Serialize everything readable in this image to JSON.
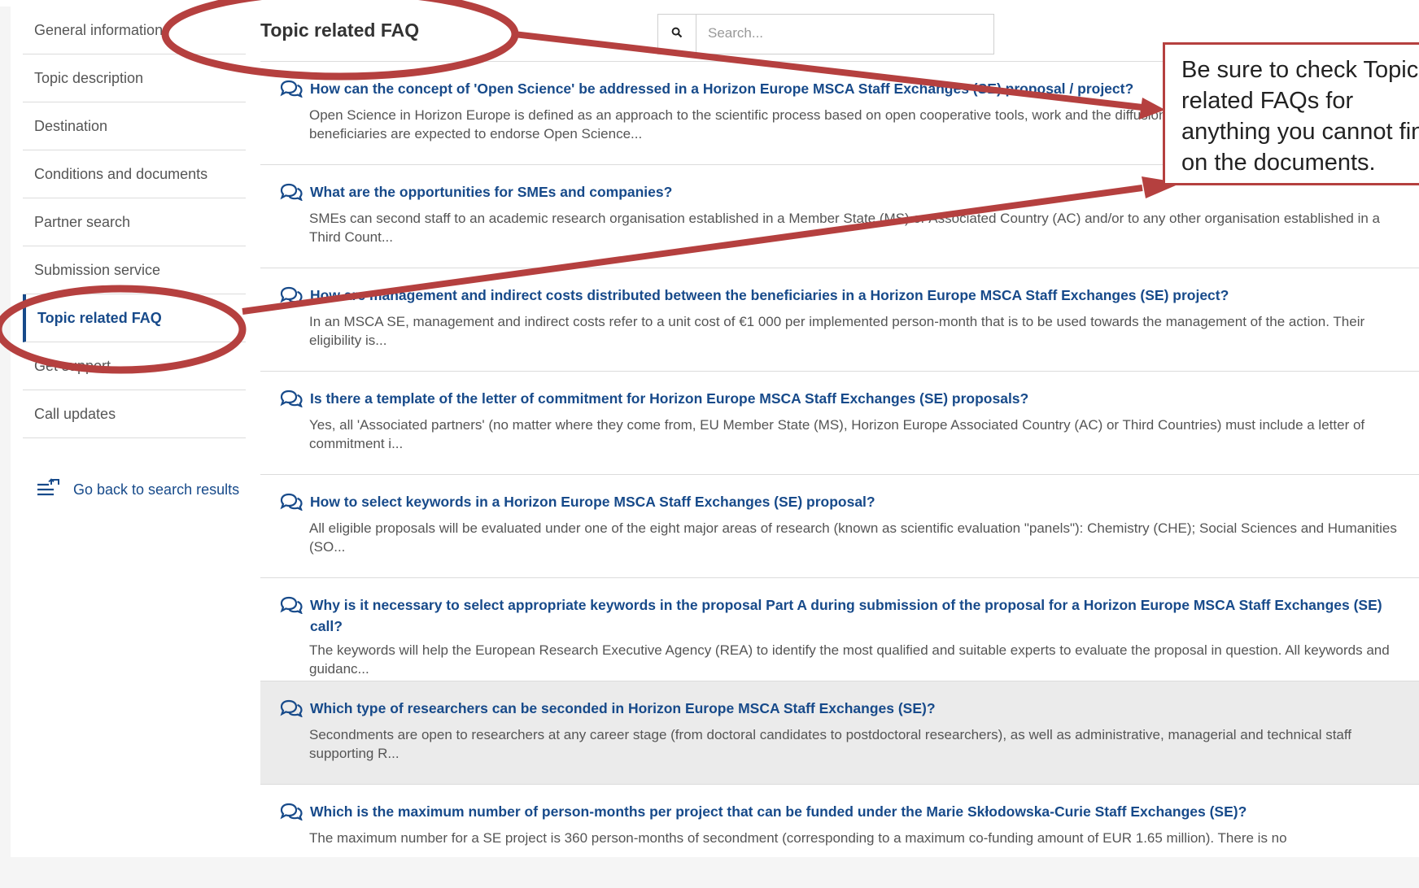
{
  "sidebar": {
    "items": [
      {
        "label": "General information"
      },
      {
        "label": "Topic description"
      },
      {
        "label": "Destination"
      },
      {
        "label": "Conditions and documents"
      },
      {
        "label": "Partner search"
      },
      {
        "label": "Submission service"
      },
      {
        "label": "Topic related FAQ",
        "active": true
      },
      {
        "label": "Get support"
      },
      {
        "label": "Call updates"
      }
    ],
    "back_link": "Go back to search results"
  },
  "header": {
    "title": "Topic related FAQ",
    "search_placeholder": "Search..."
  },
  "faqs": [
    {
      "q": "How can the concept of 'Open Science' be addressed in a Horizon Europe MSCA Staff Exchanges (SE) proposal / project?",
      "a": "Open Science in Horizon Europe is defined as an approach to the scientific process based on open cooperative tools, work and the diffusion of knowledge. All applicants and beneficiaries are expected to endorse Open Science..."
    },
    {
      "q": "What are the opportunities for SMEs and companies?",
      "a": "SMEs can second staff to an academic research organisation established in a Member State (MS) or Associated Country (AC) and/or to any other organisation established in a Third Count..."
    },
    {
      "q": "How are management and indirect costs distributed between the beneficiaries in a Horizon Europe MSCA Staff Exchanges (SE) project?",
      "a": "In an MSCA SE, management and indirect costs refer to a unit cost of €1 000 per implemented person-month that is to be used towards the management of the action. Their eligibility is..."
    },
    {
      "q": "Is there a template of the letter of commitment for Horizon Europe MSCA Staff Exchanges (SE) proposals?",
      "a": "Yes, all 'Associated partners' (no matter where they come from, EU Member State (MS), Horizon Europe Associated Country (AC) or Third Countries) must include a letter of commitment i..."
    },
    {
      "q": "How to select keywords in a Horizon Europe MSCA Staff Exchanges (SE) proposal?",
      "a": "All eligible proposals will be evaluated under one of the eight major areas of research (known as scientific evaluation \"panels\"): Chemistry (CHE); Social Sciences and Humanities (SO..."
    },
    {
      "q": "Why is it necessary to select appropriate keywords in the proposal Part A during submission of the proposal for a Horizon Europe MSCA Staff Exchanges (SE) call?",
      "a": "The keywords will help the European Research Executive Agency (REA) to identify the most qualified and suitable experts to evaluate the proposal in question. All keywords and guidanc..."
    },
    {
      "q": "Which type of researchers can be seconded in Horizon Europe MSCA Staff Exchanges (SE)?",
      "a": "Secondments are open to researchers at any career stage (from doctoral candidates to postdoctoral researchers), as well as administrative, managerial and technical staff supporting R...",
      "hovered": true
    },
    {
      "q": "Which is the maximum number of person-months per project that can be funded under the Marie Skłodowska-Curie Staff Exchanges (SE)?",
      "a": "The maximum number for a SE project is 360 person-months of secondment (corresponding to a maximum co-funding amount of EUR 1.65 million). There is no"
    }
  ],
  "annotation": {
    "lines": [
      "Be sure to check Topic",
      "related FAQs for",
      "anything you cannot find",
      "on the documents."
    ]
  },
  "colors": {
    "link_blue": "#174a8a",
    "annotation_red": "#b5403f",
    "hover_row": "#ebebeb"
  }
}
